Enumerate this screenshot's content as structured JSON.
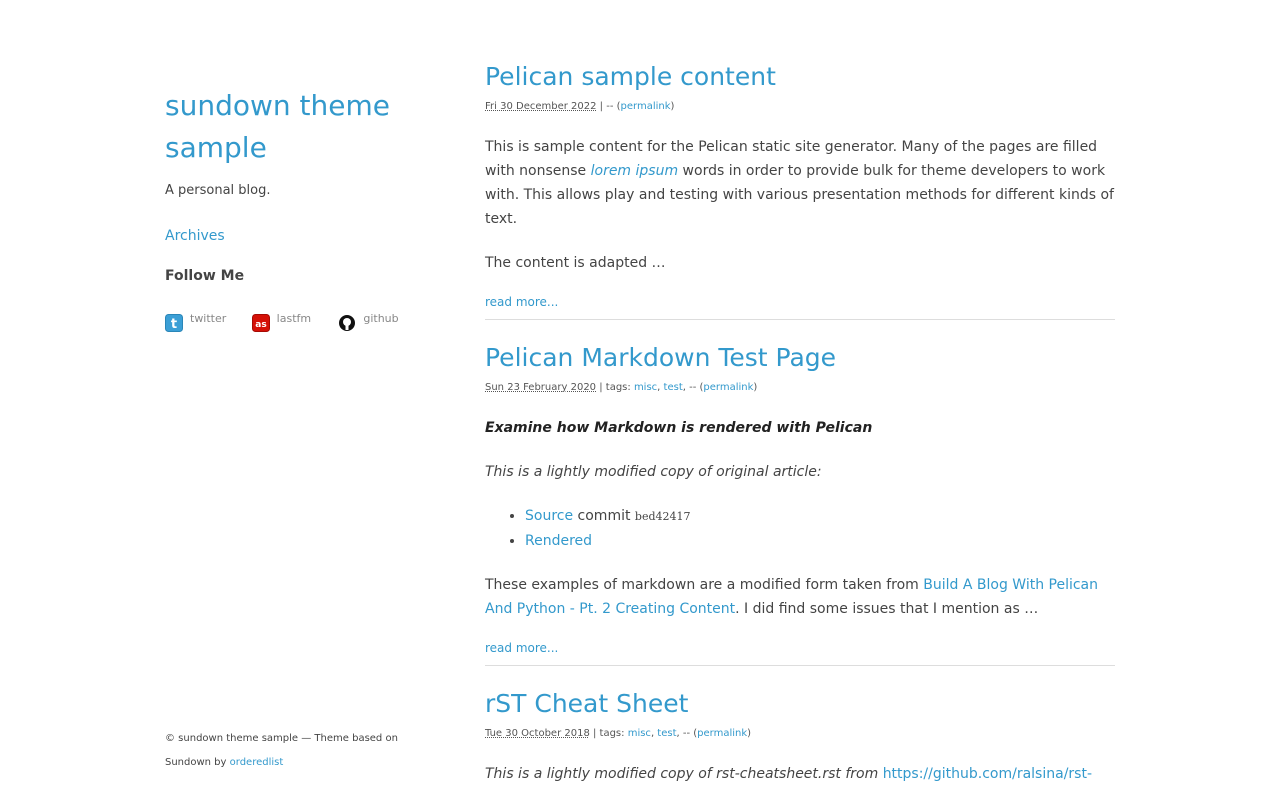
{
  "sidebar": {
    "title": "sundown theme sample",
    "tagline": "A personal blog.",
    "archives_label": "Archives",
    "follow_heading": "Follow Me",
    "social": [
      {
        "label": "twitter",
        "icon": "twitter-icon",
        "color": "#3b9fd6"
      },
      {
        "label": "lastfm",
        "icon": "lastfm-icon",
        "color": "#d51007"
      },
      {
        "label": "github",
        "icon": "github-icon",
        "color": "#111111"
      }
    ]
  },
  "footer": {
    "text": "© sundown theme sample — Theme based on Sundown by ",
    "link": "orderedlist"
  },
  "articles": [
    {
      "title": "Pelican sample content",
      "date": "Fri 30 December 2022",
      "meta_sep": " | -- (",
      "permalink": "permalink",
      "meta_end": ")",
      "p1_before": "This is sample content for the Pelican static site generator. Many of the pages are filled with nonsense ",
      "p1_link": "lorem ipsum",
      "p1_after": " words in order to provide bulk for theme developers to work with. This allows play and testing with various presentation methods for different kinds of text.",
      "p2": "The content is adapted …",
      "read_more": "read more..."
    },
    {
      "title": "Pelican Markdown Test Page",
      "date": "Sun 23 February 2020",
      "tags_prefix": " | tags: ",
      "tag1": "misc",
      "tag2": "test",
      "meta_sep": ", -- (",
      "permalink": "permalink",
      "meta_end": ")",
      "lead": "Examine how Markdown is rendered with Pelican",
      "copy_note": "This is a lightly modified copy of original article:",
      "list": [
        {
          "link": "Source",
          "text": " commit ",
          "hash": "bed42417"
        },
        {
          "link": "Rendered"
        }
      ],
      "p_before": "These examples of markdown are a modified form taken from ",
      "p_link": "Build A Blog With Pelican And Python - Pt. 2 Creating Content",
      "p_after": ". I did find some issues that I mention as …",
      "read_more": "read more..."
    },
    {
      "title": "rST Cheat Sheet",
      "date": "Tue 30 October 2018",
      "tags_prefix": " | tags: ",
      "tag1": "misc",
      "tag2": "test",
      "meta_sep": ", -- (",
      "permalink": "permalink",
      "meta_end": ")",
      "p_before": "This is a lightly modified copy of rst-cheatsheet.rst from ",
      "p_link": "https://github.com/ralsina/rst-"
    }
  ]
}
